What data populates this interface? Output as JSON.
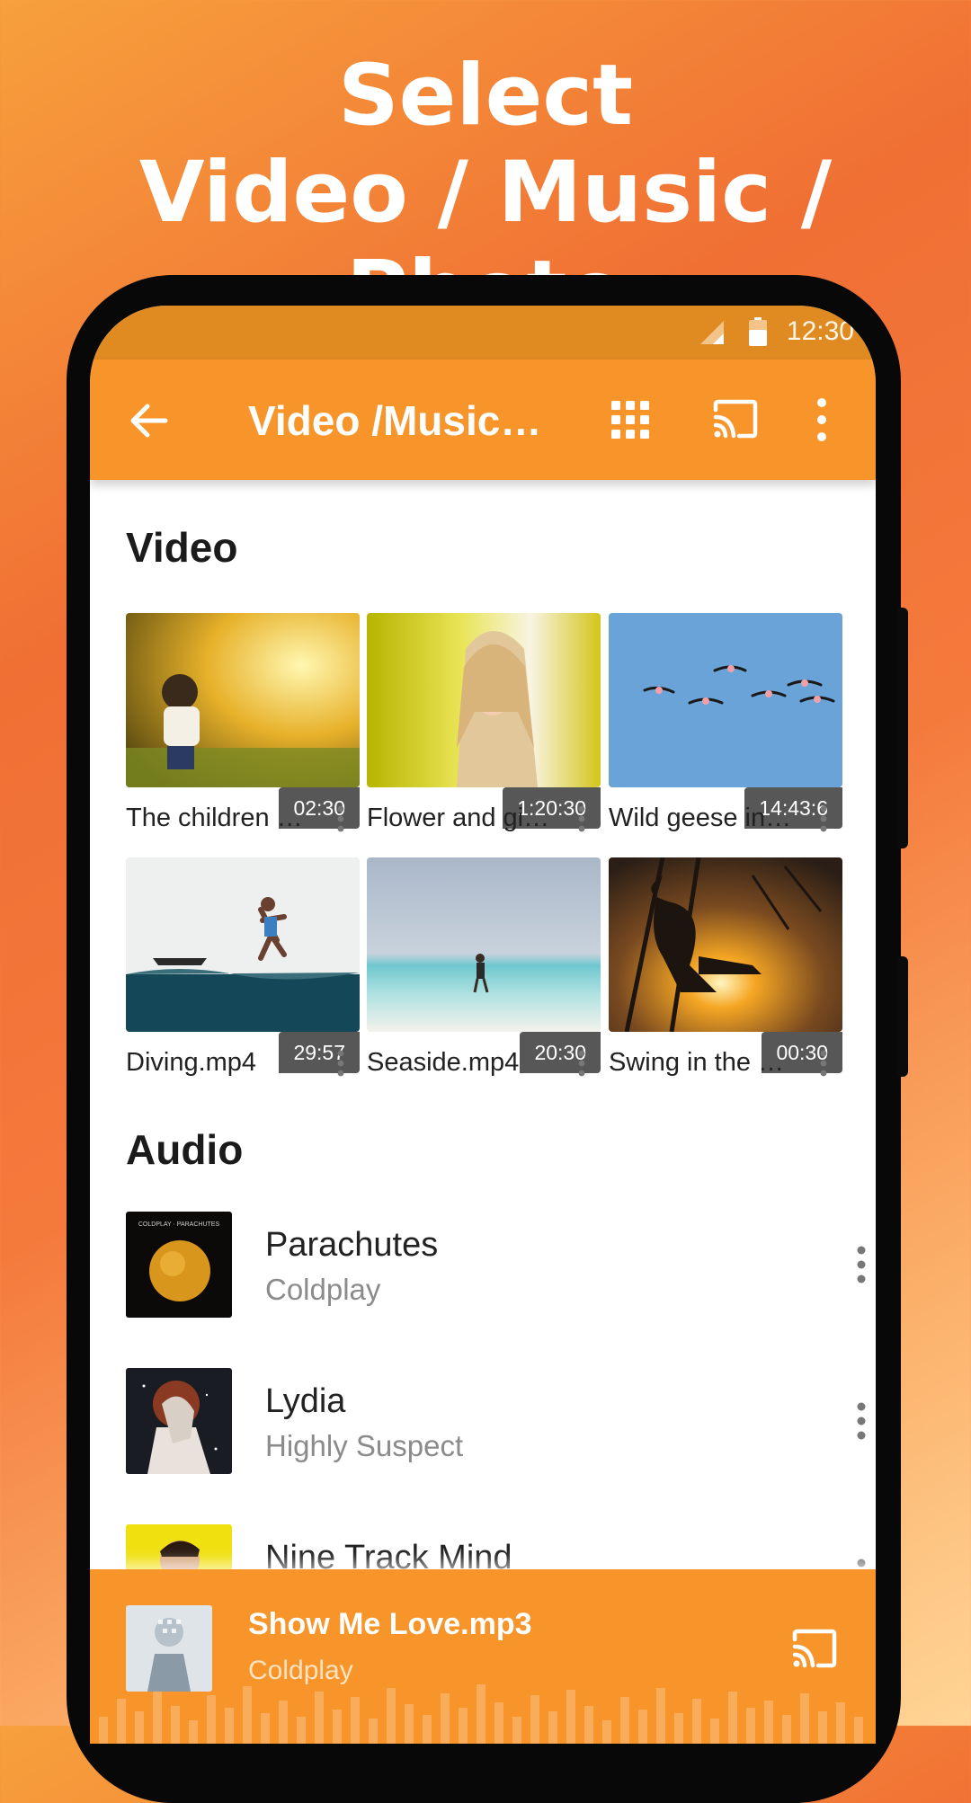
{
  "promo": {
    "line1": "Select",
    "line2": "Video / Music / Photo"
  },
  "status_bar": {
    "time": "12:30",
    "icons": [
      "signal-icon",
      "battery-icon"
    ]
  },
  "app_bar": {
    "title": "Video /Music…",
    "icons": [
      "back-arrow-icon",
      "grid-view-icon",
      "cast-icon",
      "more-vert-icon"
    ]
  },
  "video_section": {
    "title": "Video",
    "items": [
      {
        "name": "The children …",
        "duration": "02:30"
      },
      {
        "name": "Flower and gi…",
        "duration": "1:20:30"
      },
      {
        "name": "Wild geese in…",
        "duration": "14:43:6"
      },
      {
        "name": "Diving.mp4",
        "duration": "29:57"
      },
      {
        "name": "Seaside.mp4",
        "duration": "20:30"
      },
      {
        "name": "Swing in the …",
        "duration": "00:30"
      }
    ]
  },
  "audio_section": {
    "title": "Audio",
    "items": [
      {
        "title": "Parachutes",
        "artist": "Coldplay"
      },
      {
        "title": "Lydia",
        "artist": "Highly Suspect"
      },
      {
        "title": "Nine Track Mind",
        "artist": ""
      }
    ],
    "album_art_text": "COLDPLAY · PARACHUTES"
  },
  "now_playing": {
    "title": "Show Me Love.mp3",
    "artist": "Coldplay"
  },
  "colors": {
    "app_bar": "#f8952a",
    "status_bar": "#e08a22",
    "background_top": "#f06f34",
    "background_bottom": "#ffd596"
  }
}
